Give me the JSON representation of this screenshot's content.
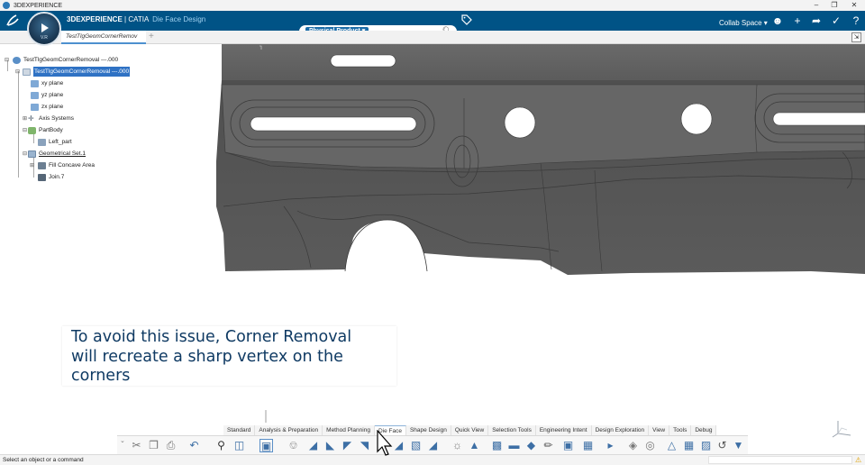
{
  "window": {
    "title": "3DEXPERIENCE",
    "controls": {
      "minimize": "–",
      "restore": "❐",
      "close": "✕"
    }
  },
  "header": {
    "brand_bold": "3DEXPERIENCE",
    "brand_sep": " | CATIA ",
    "app_name": "Die Face Design",
    "compass_version": "V.R",
    "search_scope": "Physical Product ▾",
    "search_placeholder": "",
    "collab_space": "Collab Space ▾",
    "icons": [
      "user-icon",
      "add-icon",
      "share-icon",
      "tools-icon",
      "help-icon"
    ],
    "accent": "#005386"
  },
  "tabs": {
    "active_label": "TestTlgGeomCornerRemov",
    "new_tab": "+"
  },
  "tree": {
    "nodes": [
      {
        "id": "root",
        "label": "TestTlgGeomCornerRemoval ---.000",
        "icon": "product-icon",
        "selected": false,
        "underline": false
      },
      {
        "id": "part",
        "label": "TestTlgGeomCornerRemoval ---.000",
        "icon": "part-icon",
        "selected": true,
        "underline": false
      },
      {
        "id": "xy",
        "label": "xy plane",
        "icon": "plane-icon",
        "selected": false,
        "underline": false
      },
      {
        "id": "yz",
        "label": "yz plane",
        "icon": "plane-icon",
        "selected": false,
        "underline": false
      },
      {
        "id": "zx",
        "label": "zx plane",
        "icon": "plane-icon",
        "selected": false,
        "underline": false
      },
      {
        "id": "axis",
        "label": "Axis Systems",
        "icon": "axis-icon",
        "selected": false,
        "underline": false
      },
      {
        "id": "body",
        "label": "PartBody",
        "icon": "body-icon",
        "selected": false,
        "underline": false
      },
      {
        "id": "leftpart",
        "label": "Left_part",
        "icon": "solid-icon",
        "selected": false,
        "underline": false
      },
      {
        "id": "gset",
        "label": "Geometrical Set.1",
        "icon": "geoset-icon",
        "selected": false,
        "underline": true
      },
      {
        "id": "fill",
        "label": "Fill Concave Area",
        "icon": "surface-icon",
        "selected": false,
        "underline": false
      },
      {
        "id": "join",
        "label": "Join.7",
        "icon": "join-icon",
        "selected": false,
        "underline": false
      }
    ]
  },
  "caption": {
    "lines": [
      "To avoid this issue, Corner Removal",
      "will recreate a sharp vertex on the",
      "corners"
    ]
  },
  "action_bar": {
    "sections": [
      "Standard",
      "Analysis & Preparation",
      "Method Planning",
      "Die Face",
      "Shape Design",
      "Quick View",
      "Selection Tools",
      "Engineering Intent",
      "Design Exploration",
      "View",
      "Tools",
      "Debug"
    ],
    "active_section": "Die Face",
    "icons": [
      "cut-icon",
      "copy-icon",
      "paste-icon",
      "undo-icon",
      "zoom-icon",
      "view-mode-icon",
      "fit-all-icon",
      "measure-icon",
      "die-addendum-icon",
      "binder-icon",
      "profile-icon",
      "surface-icon",
      "fillet-icon",
      "extend-icon",
      "trim-icon",
      "corner-icon",
      "blend-icon",
      "offset-icon",
      "patch-icon",
      "stamp-icon",
      "flange-icon",
      "draft-icon",
      "fill-icon",
      "join-icon",
      "split-icon",
      "analysis-icon",
      "check-icon",
      "section-icon",
      "render-icon",
      "capture-icon"
    ]
  },
  "status": {
    "message": "Select an object or a command"
  }
}
